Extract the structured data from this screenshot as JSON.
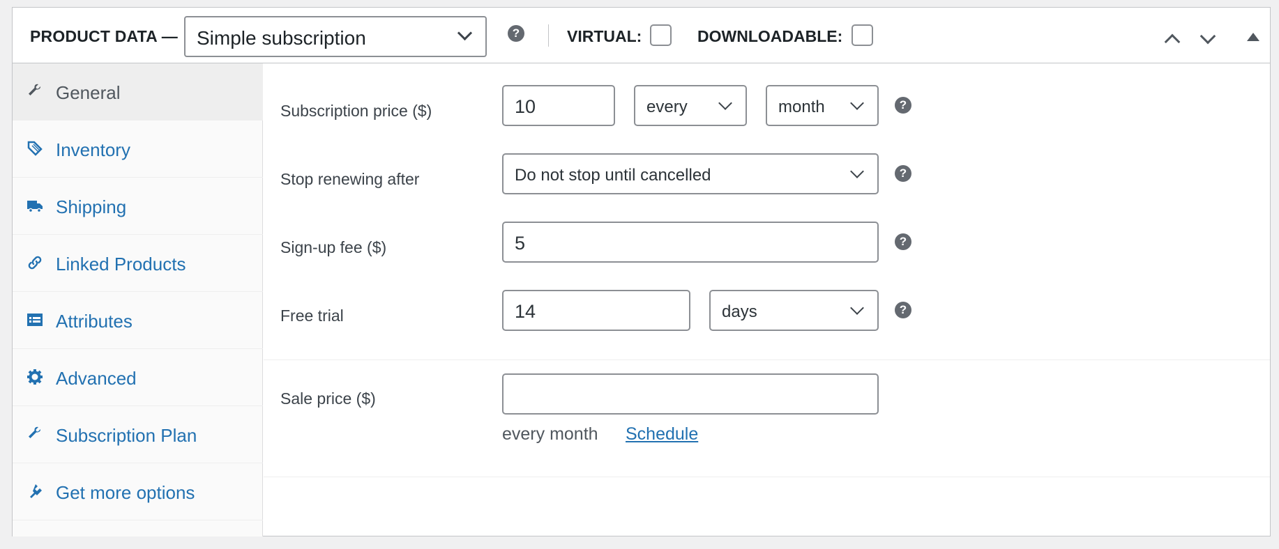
{
  "header": {
    "title": "PRODUCT DATA —",
    "product_type": "Simple subscription",
    "virtual_label": "VIRTUAL:",
    "downloadable_label": "DOWNLOADABLE:",
    "help_glyph": "?"
  },
  "sidebar": {
    "items": [
      {
        "label": "General",
        "icon": "wrench-icon",
        "active": true
      },
      {
        "label": "Inventory",
        "icon": "tag-icon"
      },
      {
        "label": "Shipping",
        "icon": "truck-icon"
      },
      {
        "label": "Linked Products",
        "icon": "link-icon"
      },
      {
        "label": "Attributes",
        "icon": "list-card-icon"
      },
      {
        "label": "Advanced",
        "icon": "gear-icon"
      },
      {
        "label": "Subscription Plan",
        "icon": "wrench-icon"
      },
      {
        "label": "Get more options",
        "icon": "plugin-icon"
      }
    ]
  },
  "fields": {
    "subscription_price": {
      "label": "Subscription price ($)",
      "value": "10",
      "interval": "every",
      "period": "month"
    },
    "stop_renewing": {
      "label": "Stop renewing after",
      "value": "Do not stop until cancelled"
    },
    "signup_fee": {
      "label": "Sign-up fee ($)",
      "value": "5"
    },
    "free_trial": {
      "label": "Free trial",
      "value": "14",
      "period": "days"
    },
    "sale_price": {
      "label": "Sale price ($)",
      "value": "",
      "suffix": "every month",
      "schedule_link": "Schedule"
    }
  },
  "colors": {
    "link": "#2271b1",
    "help": "#646970",
    "active_tab_bg": "#eeeeee"
  }
}
